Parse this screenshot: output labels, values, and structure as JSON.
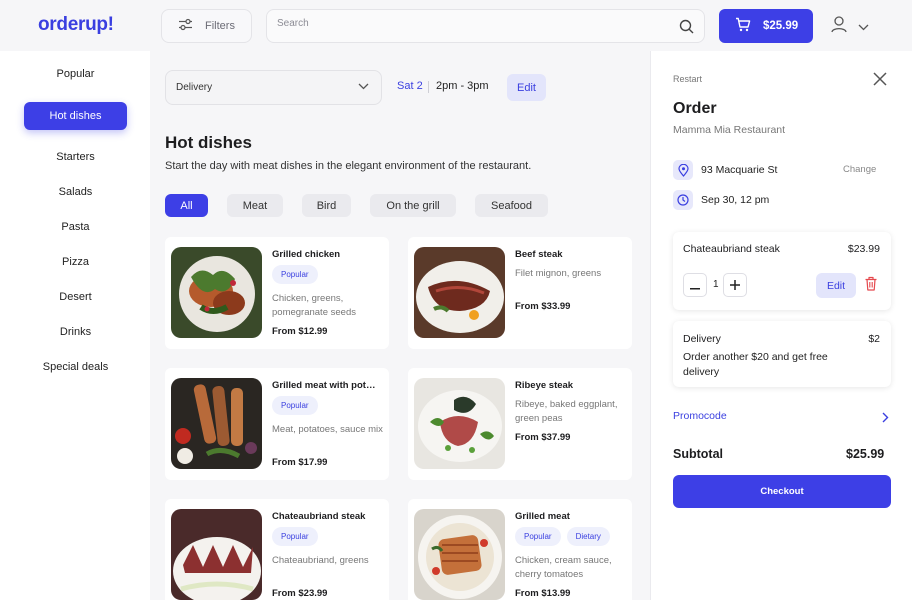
{
  "app": {
    "logo": "orderup!"
  },
  "header": {
    "filters_label": "Filters",
    "search_placeholder": "Search",
    "cart_total": "$25.99"
  },
  "sidebar": {
    "items": [
      {
        "label": "Popular"
      },
      {
        "label": "Hot dishes",
        "active": true
      },
      {
        "label": "Starters"
      },
      {
        "label": "Salads"
      },
      {
        "label": "Pasta"
      },
      {
        "label": "Pizza"
      },
      {
        "label": "Desert"
      },
      {
        "label": "Drinks"
      },
      {
        "label": "Special deals"
      }
    ]
  },
  "main": {
    "delivery_mode": "Delivery",
    "date": "Sat 2",
    "time": "2pm - 3pm",
    "edit_label": "Edit",
    "title": "Hot dishes",
    "description": "Start the day with meat dishes in the elegant environment of the restaurant.",
    "chips": [
      {
        "label": "All",
        "active": true
      },
      {
        "label": "Meat"
      },
      {
        "label": "Bird"
      },
      {
        "label": "On the grill"
      },
      {
        "label": "Seafood"
      }
    ],
    "dishes": [
      {
        "name": "Grilled chicken",
        "tags": [
          "Popular"
        ],
        "description": "Chicken, greens, pomegranate seeds",
        "price": "From $12.99"
      },
      {
        "name": "Beef steak",
        "tags": [],
        "description": "Filet mignon, greens",
        "price": "From $33.99"
      },
      {
        "name": "Grilled meat with pot…",
        "tags": [
          "Popular"
        ],
        "description": "Meat, potatoes, sauce mix",
        "price": "From $17.99"
      },
      {
        "name": "Ribeye steak",
        "tags": [],
        "description": "Ribeye, baked eggplant, green peas",
        "price": "From $37.99"
      },
      {
        "name": "Chateaubriand steak",
        "tags": [
          "Popular"
        ],
        "description": "Chateaubriand, greens",
        "price": "From $23.99"
      },
      {
        "name": "Grilled meat",
        "tags": [
          "Popular",
          "Dietary"
        ],
        "description": "Chicken, cream sauce, cherry tomatoes",
        "price": "From $13.99"
      }
    ]
  },
  "order": {
    "restart_label": "Restart",
    "title": "Order",
    "restaurant": "Mamma Mia Restaurant",
    "address": "93 Macquarie St",
    "change_label": "Change",
    "datetime": "Sep 30, 12 pm",
    "item": {
      "name": "Chateaubriand steak",
      "price": "$23.99",
      "quantity": "1",
      "edit_label": "Edit"
    },
    "delivery": {
      "label": "Delivery",
      "price": "$2",
      "note": "Order another $20 and get free delivery"
    },
    "promocode_label": "Promocode",
    "subtotal_label": "Subtotal",
    "subtotal_value": "$25.99",
    "checkout_label": "Checkout"
  },
  "colors": {
    "accent": "#3d3fe6",
    "accent_light": "#e3e5fb",
    "danger": "#e5484d"
  }
}
